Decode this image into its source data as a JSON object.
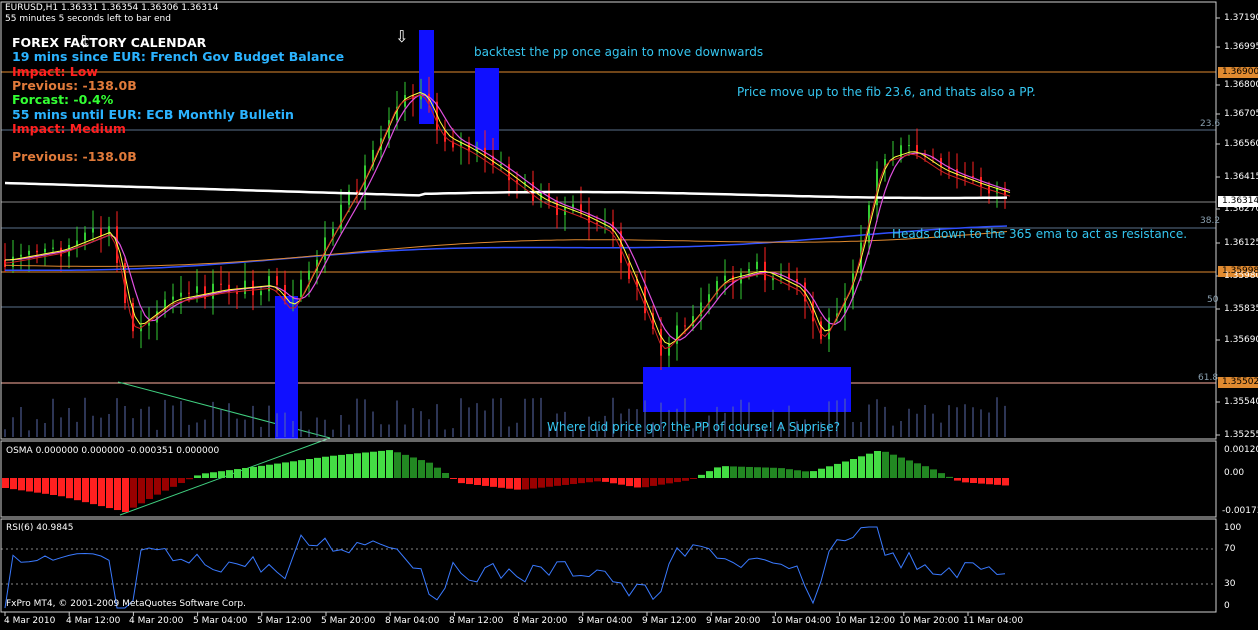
{
  "header": {
    "symbol": "EURUSD,H1  1.36331 1.36354 1.36306 1.36314",
    "timer": "55 minutes 5 seconds left to bar end"
  },
  "calendar": {
    "title": "FOREX FACTORY CALENDAR",
    "line1": "19 mins since EUR: French Gov Budget Balance",
    "line2": "Impact: Low",
    "line3": "Previous: -138.0B",
    "line4": "Forcast: -0.4%",
    "line5": "55 mins until EUR: ECB Monthly Bulletin",
    "line6": "Impact: Medium",
    "line7": "Previous: -138.0B",
    "colors": {
      "title": "#ffffff",
      "event": "#2bb3ff",
      "impact": "#ff2020",
      "previous": "#e07a3a",
      "forecast": "#33ff33"
    }
  },
  "annotations": {
    "a1": "backtest the pp once again to move downwards",
    "a2": "Price move up to the fib 23.6, and thats also a PP.",
    "a3": "Heads down to the 365 ema to act as resistance.",
    "a4": "Where did price go? the PP of course! A Suprise?"
  },
  "icons": [
    "arrow-down-icon",
    "arrow-down-icon"
  ],
  "price_axis": {
    "labels": [
      "1.37190",
      "1.36995",
      "1.36800",
      "1.36705",
      "1.36560",
      "1.36415",
      "1.36270",
      "1.36125",
      "1.35980",
      "1.35835",
      "1.35690",
      "1.35540",
      "1.35255"
    ],
    "highlight": [
      {
        "text": "1.36900",
        "color": "#e08a30"
      },
      {
        "text": "1.36314",
        "color": "#ffffff"
      },
      {
        "text": "1.35998",
        "color": "#e08a30"
      },
      {
        "text": "1.35502",
        "color": "#e08a30"
      }
    ]
  },
  "fib_levels": [
    {
      "label": "23.6"
    },
    {
      "label": "38.2"
    },
    {
      "label": "50"
    },
    {
      "label": "61.8"
    }
  ],
  "osma": {
    "title": "OSMA 0.000000 0.000000 -0.000351 0.000000",
    "axis": [
      "0.00120",
      "0.00",
      "-0.00173"
    ]
  },
  "rsi": {
    "title": "RSI(6) 40.9845",
    "axis": [
      "100",
      "70",
      "30",
      "0"
    ]
  },
  "time_axis": [
    "4 Mar 2010",
    "4 Mar 12:00",
    "4 Mar 20:00",
    "5 Mar 04:00",
    "5 Mar 12:00",
    "5 Mar 20:00",
    "8 Mar 04:00",
    "8 Mar 12:00",
    "8 Mar 20:00",
    "9 Mar 04:00",
    "9 Mar 12:00",
    "9 Mar 20:00",
    "10 Mar 04:00",
    "10 Mar 12:00",
    "10 Mar 20:00",
    "11 Mar 04:00"
  ],
  "copyright": "FxPro MT4, © 2001-2009 MetaQuotes Software Corp."
}
